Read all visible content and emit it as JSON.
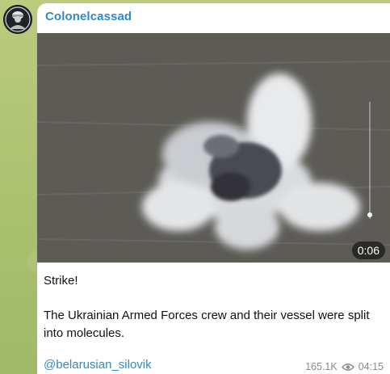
{
  "channel": {
    "name": "Colonelcassad",
    "avatar_icon": "soldier-avatar-icon"
  },
  "video": {
    "duration": "0:06"
  },
  "message": {
    "paragraphs": [
      "Strike!",
      "The Ukrainian Armed Forces crew and their vessel were split into molecules."
    ],
    "link": "@belarusian_silovik",
    "views": "165.1K",
    "views_icon": "eye-icon",
    "time": "04:15"
  },
  "colors": {
    "accent": "#2f8ac8",
    "background": "#b9c77a"
  }
}
